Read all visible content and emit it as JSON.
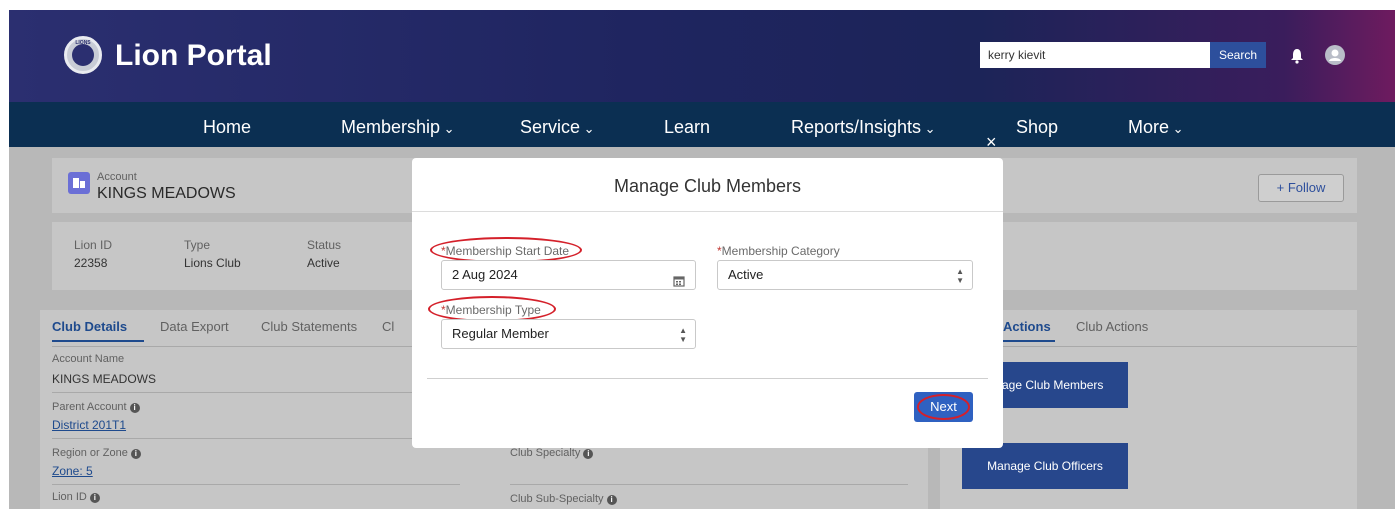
{
  "header": {
    "app_title": "Lion Portal",
    "logo_text": "LIONS",
    "search_value": "kerry kievit",
    "search_button": "Search"
  },
  "nav": {
    "home": "Home",
    "membership": "Membership",
    "service": "Service",
    "learn": "Learn",
    "reports": "Reports/Insights",
    "shop": "Shop",
    "more": "More"
  },
  "account": {
    "label": "Account",
    "name": "KINGS MEADOWS",
    "follow_label": "+ Follow",
    "fields": {
      "lion_id_label": "Lion ID",
      "lion_id_value": "22358",
      "type_label": "Type",
      "type_value": "Lions Club",
      "status_label": "Status",
      "status_value": "Active"
    }
  },
  "tabs": {
    "club_details": "Club Details",
    "data_export": "Data Export",
    "club_statements": "Club Statements",
    "cut": "Cl"
  },
  "details": {
    "account_name_label": "Account Name",
    "account_name_value": "KINGS MEADOWS",
    "parent_account_label": "Parent Account",
    "parent_account_value": "District 201T1",
    "region_label": "Region or Zone",
    "region_value": "Zone: 5",
    "lion_id_label": "Lion ID",
    "club_specialty_label": "Club Specialty",
    "club_sub_specialty_label": "Club Sub-Specialty"
  },
  "actions": {
    "tab_active": "Actions",
    "tab_club": "Club Actions",
    "manage_members": "age Club Members",
    "manage_officers": "Manage Club Officers"
  },
  "modal": {
    "title": "Manage Club Members",
    "close": "×",
    "start_date_label": "Membership Start Date",
    "start_date_value": "2 Aug 2024",
    "category_label": "Membership Category",
    "category_value": "Active",
    "type_label": "Membership Type",
    "type_value": "Regular Member",
    "required_mark": "*",
    "next_button": "Next"
  },
  "colors": {
    "header_start": "#2b2f70",
    "header_end": "#6e1b5f",
    "nav_bg": "#0b2f52",
    "button_blue": "#2d4f9c",
    "highlight_red": "#d4202a"
  }
}
